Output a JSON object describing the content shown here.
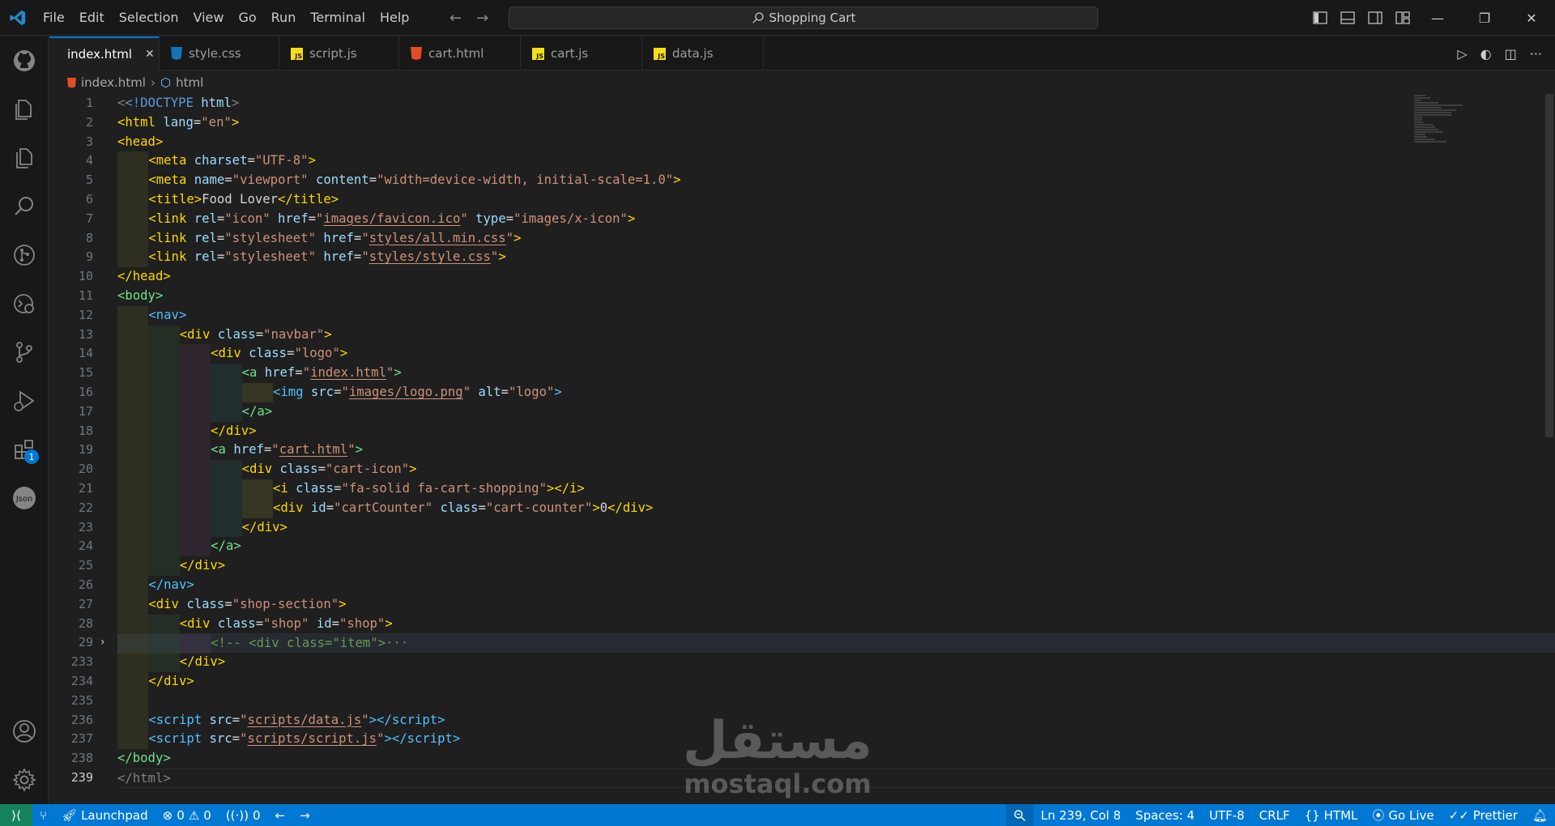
{
  "title_bar": {
    "menu": [
      "File",
      "Edit",
      "Selection",
      "View",
      "Go",
      "Run",
      "Terminal",
      "Help"
    ],
    "search_text": "Shopping Cart",
    "back_glyph": "←",
    "forward_glyph": "→"
  },
  "tabs": [
    {
      "label": "index.html",
      "icon": "html-file-icon",
      "active": true
    },
    {
      "label": "style.css",
      "icon": "css-file-icon",
      "active": false
    },
    {
      "label": "script.js",
      "icon": "js-file-icon",
      "active": false
    },
    {
      "label": "cart.html",
      "icon": "html-file-icon",
      "active": false
    },
    {
      "label": "cart.js",
      "icon": "js-file-icon",
      "active": false
    },
    {
      "label": "data.js",
      "icon": "js-file-icon",
      "active": false
    }
  ],
  "breadcrumb": {
    "file": "index.html",
    "symbol": "html"
  },
  "activity_bar": {
    "items": [
      "github-icon",
      "explorer-icon",
      "copy-files-icon",
      "search-icon",
      "source-control-graph-icon",
      "remote-explorer-icon",
      "source-control-icon",
      "run-debug-icon",
      "extensions-icon",
      "json-icon"
    ],
    "extensions_badge": "1",
    "bottom": [
      "account-icon",
      "settings-gear-icon"
    ]
  },
  "line_numbers": [
    "1",
    "2",
    "3",
    "4",
    "5",
    "6",
    "7",
    "8",
    "9",
    "10",
    "11",
    "12",
    "13",
    "14",
    "15",
    "16",
    "17",
    "18",
    "19",
    "20",
    "21",
    "22",
    "23",
    "24",
    "25",
    "26",
    "27",
    "28",
    "29",
    "233",
    "234",
    "235",
    "236",
    "237",
    "238",
    "239"
  ],
  "code_text": {
    "l1_doctype": "<!DOCTYPE",
    "l1_html": "html",
    "l2_lang": "lang",
    "l2_lang_val": "\"en\"",
    "l4_charset": "charset",
    "l4_charset_val": "\"UTF-8\"",
    "l5_name": "name",
    "l5_name_val": "\"viewport\"",
    "l5_content": "content",
    "l5_content_val": "\"width=device-width, initial-scale=1.0\"",
    "l6_title_text": "Food Lover",
    "l7_rel_val": "\"icon\"",
    "l7_href_val": "images/favicon.ico",
    "l7_type_val": "\"images/x-icon\"",
    "l8_rel_val": "\"stylesheet\"",
    "l8_href_val": "styles/all.min.css",
    "l9_rel_val": "\"stylesheet\"",
    "l9_href_val": "styles/style.css",
    "l13_class_val": "\"navbar\"",
    "l14_class_val": "\"logo\"",
    "l15_href_val": "index.html",
    "l16_src_val": "images/logo.png",
    "l16_alt_val": "\"logo\"",
    "l19_href_val": "cart.html",
    "l20_class_val": "\"cart-icon\"",
    "l21_class_val": "\"fa-solid fa-cart-shopping\"",
    "l22_id_val": "\"cartCounter\"",
    "l22_class_val": "\"cart-counter\"",
    "l22_text": "0",
    "l27_class_val": "\"shop-section\"",
    "l28_class_val": "\"shop\"",
    "l28_id_val": "\"shop\"",
    "l29_comment": "<!-- <div class=\"item\">",
    "l29_ellipsis": "···",
    "l236_src_val": "scripts/data.js",
    "l237_src_val": "scripts/script.js"
  },
  "watermark": {
    "arabic": "مستقل",
    "latin": "mostaql.com"
  },
  "status_bar": {
    "launchpad": "Launchpad",
    "errors": "0",
    "warnings": "0",
    "ports": "0",
    "position": "Ln 239, Col 8",
    "spaces": "Spaces: 4",
    "encoding": "UTF-8",
    "eol": "CRLF",
    "language": "HTML",
    "go_live": "Go Live",
    "prettier": "Prettier"
  },
  "colors": {
    "accent": "#0078d4",
    "remote": "#16825d",
    "editor_bg": "#1f1f1f"
  }
}
